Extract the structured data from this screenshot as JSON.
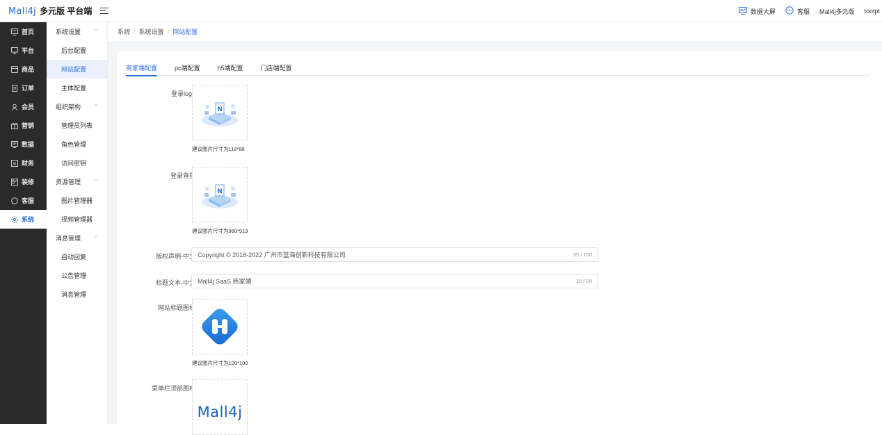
{
  "brand": {
    "logo_text": "Mall4j",
    "platform_title": "多元版 平台端"
  },
  "top_right": {
    "data_screen": "数据大屏",
    "service": "客服",
    "account": "Mall4j多元版",
    "user": "tootpt"
  },
  "sidebar": {
    "items": [
      {
        "label": "首页",
        "icon": "home-icon"
      },
      {
        "label": "平台",
        "icon": "platform-icon"
      },
      {
        "label": "商品",
        "icon": "goods-icon"
      },
      {
        "label": "订单",
        "icon": "order-icon"
      },
      {
        "label": "会员",
        "icon": "member-icon"
      },
      {
        "label": "营销",
        "icon": "gift-icon"
      },
      {
        "label": "数据",
        "icon": "data-icon"
      },
      {
        "label": "财务",
        "icon": "finance-icon"
      },
      {
        "label": "装修",
        "icon": "decorate-icon"
      },
      {
        "label": "客服",
        "icon": "chat-icon"
      },
      {
        "label": "系统",
        "icon": "gear-icon"
      }
    ],
    "active_index": 10
  },
  "submenu": {
    "groups": [
      {
        "label": "系统设置",
        "items": [
          "后台配置",
          "网站配置",
          "主体配置"
        ]
      },
      {
        "label": "组织架构",
        "items": [
          "管理员列表",
          "角色管理",
          "访问密钥"
        ]
      },
      {
        "label": "资源管理",
        "items": [
          "图片管理器",
          "视频管理器"
        ]
      },
      {
        "label": "消息管理",
        "items": [
          "自动回复",
          "公告管理",
          "消息管理"
        ]
      }
    ],
    "active_item": "网站配置"
  },
  "breadcrumb": [
    "系统",
    "系统设置",
    "网站配置"
  ],
  "tabs": [
    "商家端配置",
    "pc端配置",
    "h5端配置",
    "门店端配置"
  ],
  "active_tab": 0,
  "form": {
    "login_logo": {
      "label": "登录logo",
      "hint": "建议图片尺寸为118*88"
    },
    "login_bg": {
      "label": "登录背景",
      "hint": "建议图片尺寸为960*919"
    },
    "copyright": {
      "label": "版权声明-中文",
      "value": "Copyright © 2018-2022 广州市蓝海创新科技有限公司",
      "count": "35 / 150"
    },
    "title_text": {
      "label": "标题文本-中文",
      "value": "Mall4j SaaS 商家端",
      "count": "15 / 20"
    },
    "favicon": {
      "label": "网站标题图标",
      "hint": "建议图片尺寸为100*100"
    },
    "menu_icon": {
      "label": "菜单栏顶部图标",
      "logo_text": "Mall4j"
    }
  },
  "colors": {
    "accent": "#2f6fe0",
    "sidebar_bg": "#2a2a2a",
    "brand_blue": "#1f6fd6"
  }
}
